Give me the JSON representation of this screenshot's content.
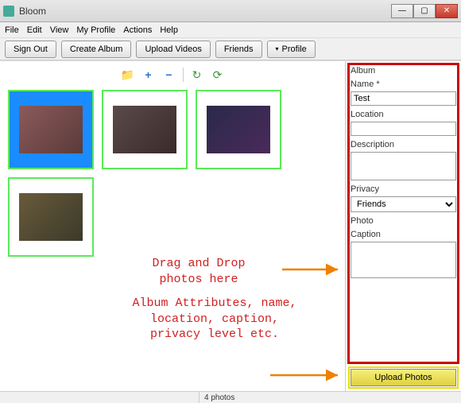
{
  "window": {
    "title": "Bloom"
  },
  "menu": {
    "file": "File",
    "edit": "Edit",
    "view": "View",
    "profile": "My Profile",
    "actions": "Actions",
    "help": "Help"
  },
  "toolbar": {
    "signout": "Sign Out",
    "create": "Create Album",
    "uploadv": "Upload Videos",
    "friends": "Friends",
    "profile": "Profile"
  },
  "form": {
    "album_label": "Album",
    "name_label": "Name *",
    "name_value": "Test",
    "location_label": "Location",
    "location_value": "",
    "description_label": "Description",
    "description_value": "",
    "privacy_label": "Privacy",
    "privacy_value": "Friends",
    "photo_label": "Photo",
    "caption_label": "Caption",
    "caption_value": "",
    "upload_button": "Upload Photos"
  },
  "annotations": {
    "drag": "Drag and Drop\nphotos here",
    "attrs": "Album Attributes, name,\nlocation, caption,\nprivacy level etc."
  },
  "status": {
    "count": "4 photos"
  }
}
